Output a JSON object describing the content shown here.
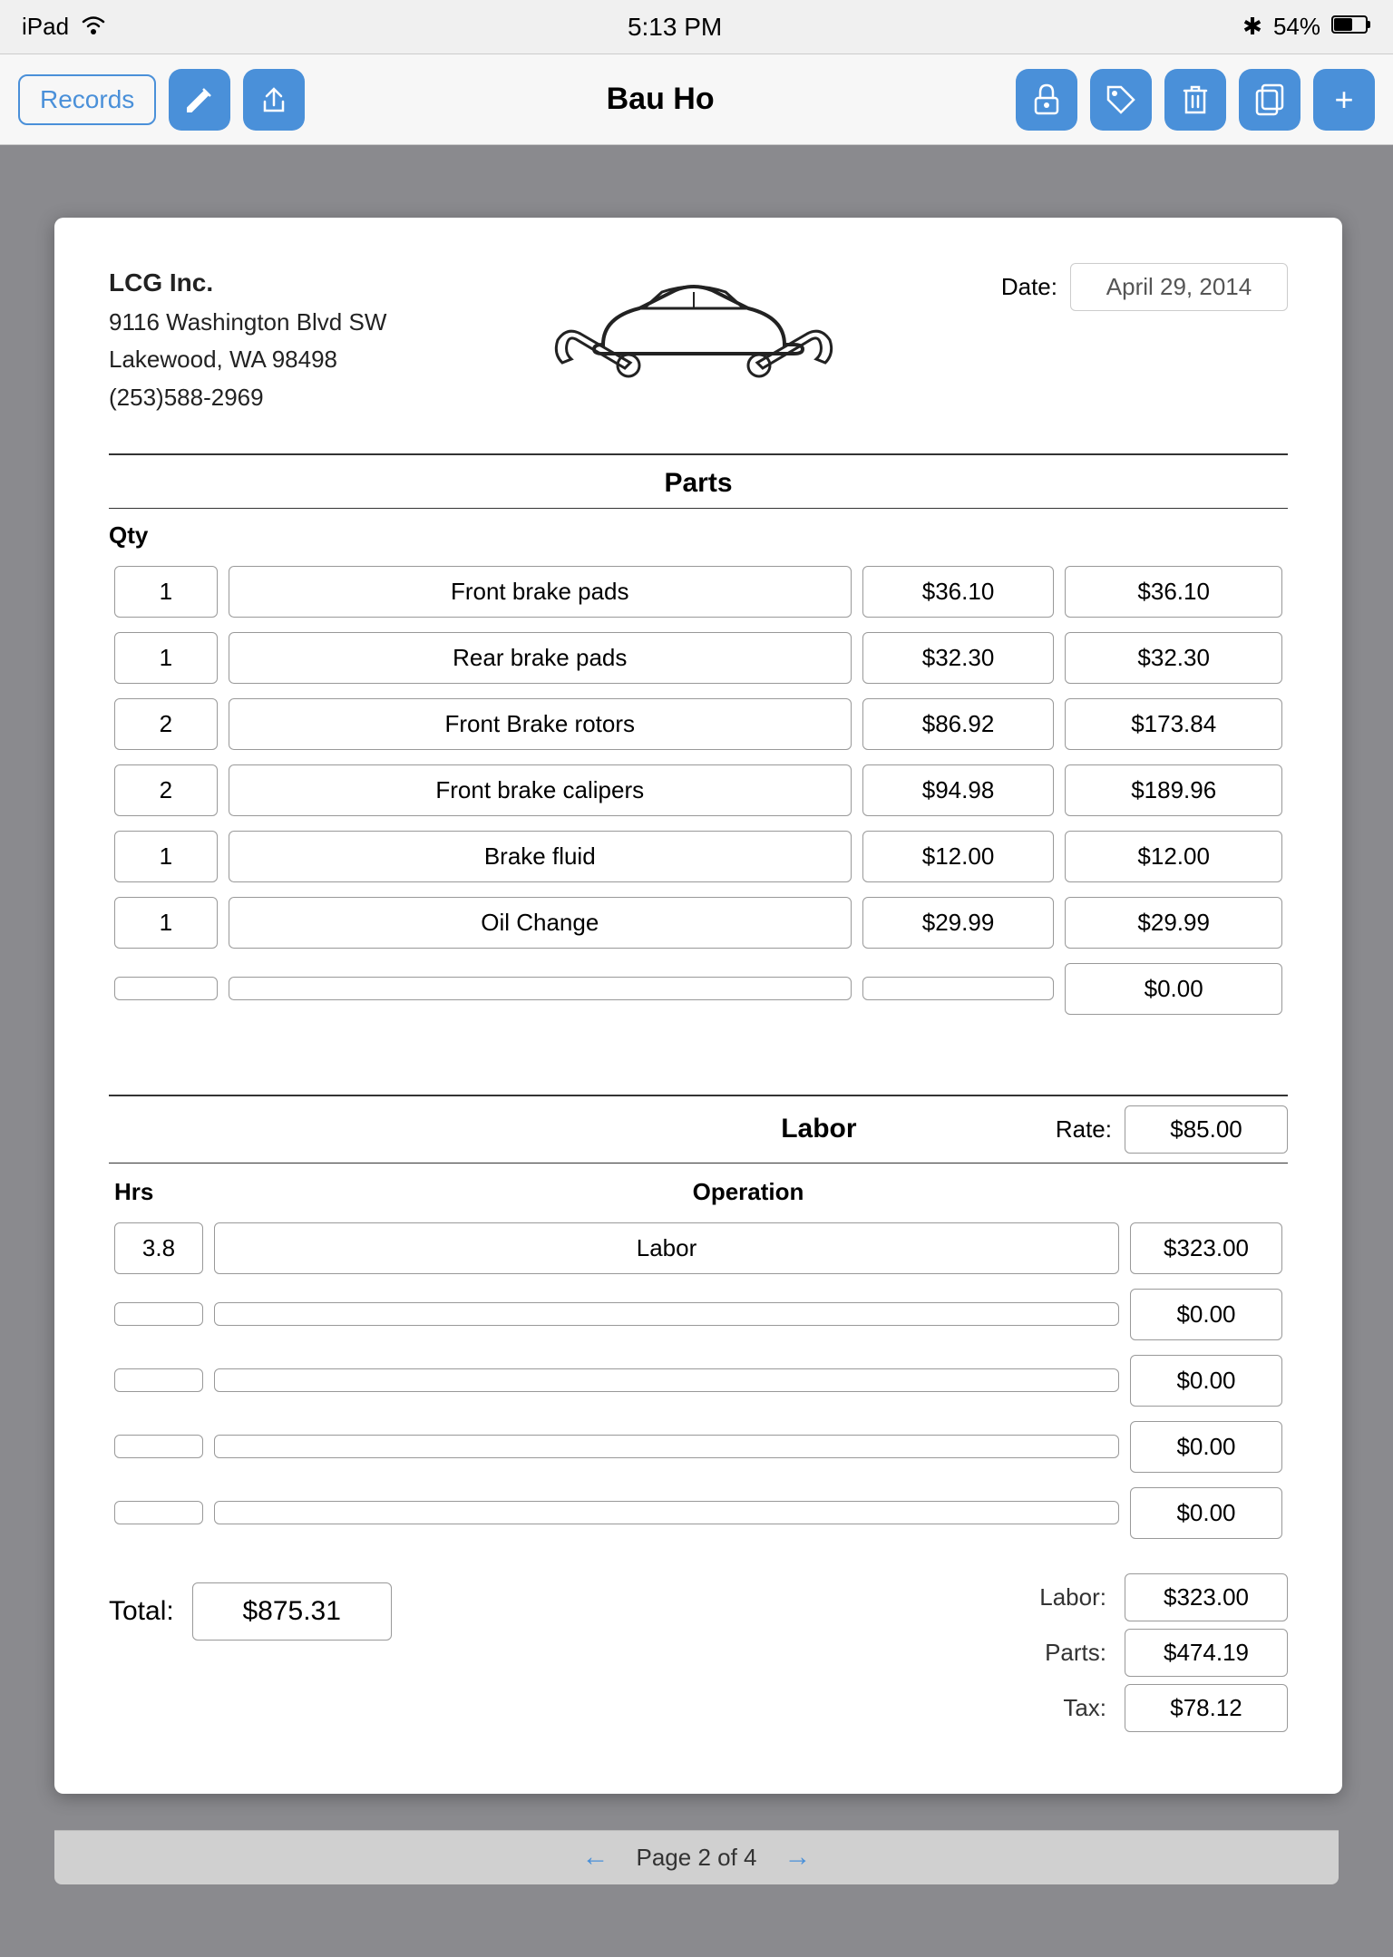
{
  "statusBar": {
    "device": "iPad",
    "wifi": "wifi",
    "time": "5:13 PM",
    "bluetooth": "BT",
    "battery": "54%"
  },
  "navBar": {
    "title": "Bau Ho",
    "recordsLabel": "Records",
    "editIcon": "✏️",
    "shareIcon": "↑",
    "lockIcon": "🔒",
    "tagIcon": "🏷",
    "trashIcon": "🗑",
    "copyIcon": "📋",
    "addIcon": "+"
  },
  "document": {
    "company": {
      "name": "LCG Inc.",
      "address1": "9116 Washington Blvd SW",
      "address2": "Lakewood, WA  98498",
      "phone": "(253)588-2969"
    },
    "dateLabel": "Date:",
    "dateValue": "April 29, 2014",
    "partsSectionTitle": "Parts",
    "qtyHeader": "Qty",
    "parts": [
      {
        "qty": "1",
        "description": "Front brake pads",
        "unitPrice": "$36.10",
        "total": "$36.10"
      },
      {
        "qty": "1",
        "description": "Rear brake pads",
        "unitPrice": "$32.30",
        "total": "$32.30"
      },
      {
        "qty": "2",
        "description": "Front Brake rotors",
        "unitPrice": "$86.92",
        "total": "$173.84"
      },
      {
        "qty": "2",
        "description": "Front brake calipers",
        "unitPrice": "$94.98",
        "total": "$189.96"
      },
      {
        "qty": "1",
        "description": "Brake fluid",
        "unitPrice": "$12.00",
        "total": "$12.00"
      },
      {
        "qty": "1",
        "description": "Oil Change",
        "unitPrice": "$29.99",
        "total": "$29.99"
      },
      {
        "qty": "",
        "description": "",
        "unitPrice": "",
        "total": "$0.00"
      }
    ],
    "laborSectionTitle": "Labor",
    "rateLabel": "Rate:",
    "rateValue": "$85.00",
    "hrsHeader": "Hrs",
    "operationHeader": "Operation",
    "laborRows": [
      {
        "hrs": "3.8",
        "operation": "Labor",
        "total": "$323.00"
      },
      {
        "hrs": "",
        "operation": "",
        "total": "$0.00"
      },
      {
        "hrs": "",
        "operation": "",
        "total": "$0.00"
      },
      {
        "hrs": "",
        "operation": "",
        "total": "$0.00"
      },
      {
        "hrs": "",
        "operation": "",
        "total": "$0.00"
      }
    ],
    "totalLabel": "Total:",
    "totalValue": "$875.31",
    "laborLabel": "Labor:",
    "laborValue": "$323.00",
    "partsLabel": "Parts:",
    "partsValue": "$474.19",
    "taxLabel": "Tax:",
    "taxValue": "$78.12"
  },
  "pagination": {
    "label": "Page 2 of 4",
    "prevArrow": "←",
    "nextArrow": "→"
  }
}
